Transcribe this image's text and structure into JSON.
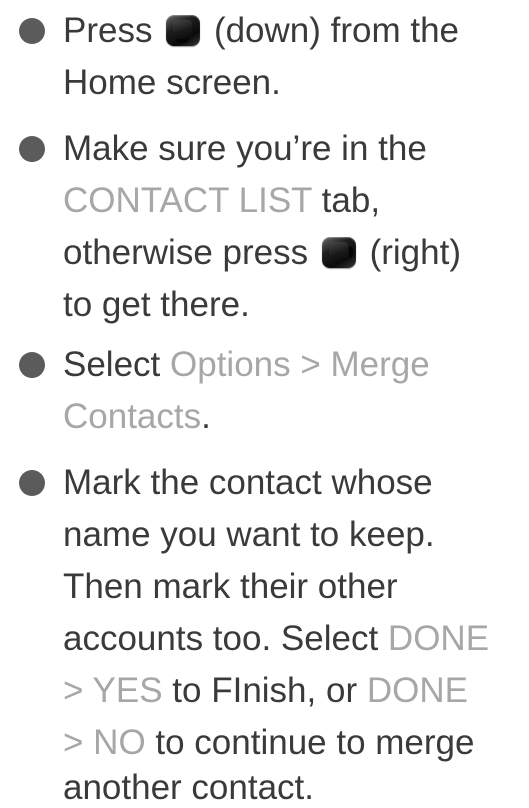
{
  "steps": [
    {
      "lines": [
        {
          "parts": [
            {
              "text": "Press",
              "style": "normal"
            },
            {
              "key": "down-key-icon"
            },
            {
              "text": "(down) from the",
              "style": "normal"
            }
          ]
        },
        {
          "parts": [
            {
              "text": "Home screen.",
              "style": "normal"
            }
          ]
        }
      ]
    },
    {
      "lines": [
        {
          "parts": [
            {
              "text": "Make sure you’re in the",
              "style": "normal"
            }
          ]
        },
        {
          "parts": [
            {
              "text": "CONTACT LIST",
              "style": "hl"
            },
            {
              "text": " tab,",
              "style": "normal"
            }
          ]
        },
        {
          "parts": [
            {
              "text": "otherwise press",
              "style": "normal"
            },
            {
              "key": "right-key-icon"
            },
            {
              "text": "(right)",
              "style": "normal"
            }
          ]
        },
        {
          "parts": [
            {
              "text": "to get there.",
              "style": "normal"
            }
          ]
        }
      ]
    },
    {
      "lines": [
        {
          "parts": [
            {
              "text": "Select ",
              "style": "normal"
            },
            {
              "text": "Options > Merge",
              "style": "hl"
            }
          ]
        },
        {
          "parts": [
            {
              "text": "Contacts",
              "style": "hl"
            },
            {
              "text": ".",
              "style": "normal"
            }
          ]
        }
      ]
    },
    {
      "lines": [
        {
          "parts": [
            {
              "text": "Mark the contact whose",
              "style": "normal"
            }
          ]
        },
        {
          "parts": [
            {
              "text": "name you want to keep.",
              "style": "normal"
            }
          ]
        },
        {
          "parts": [
            {
              "text": "Then mark their other",
              "style": "normal"
            }
          ]
        },
        {
          "parts": [
            {
              "text": "accounts too. Select ",
              "style": "normal"
            },
            {
              "text": "DONE",
              "style": "hl"
            }
          ]
        },
        {
          "parts": [
            {
              "text": "> YES",
              "style": "hl"
            },
            {
              "text": " to FInish, or ",
              "style": "normal"
            },
            {
              "text": "DONE",
              "style": "hl"
            }
          ]
        },
        {
          "parts": [
            {
              "text": "> NO",
              "style": "hl"
            },
            {
              "text": " to continue to merge",
              "style": "normal"
            }
          ]
        },
        {
          "parts": [
            {
              "text": "another contact.",
              "style": "normal"
            }
          ]
        }
      ]
    }
  ],
  "colors": {
    "body_text": "#3a3a3a",
    "highlight_text": "#a7a7a7",
    "bullet": "#5b5b5b"
  }
}
